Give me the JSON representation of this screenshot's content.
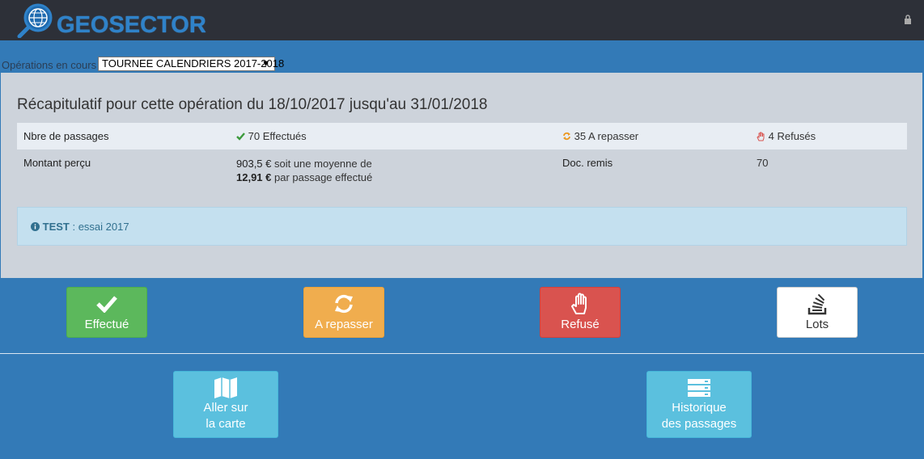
{
  "header": {
    "logo_text": "GEOSECTOR",
    "logo_icon": "globe-magnifier-icon",
    "lock_icon": "lock-icon"
  },
  "operation": {
    "label": "Opérations en cours :",
    "selected": "TOURNEE CALENDRIERS 2017-2018",
    "arrow": "▼"
  },
  "summary": {
    "title": "Récapitulatif pour cette opération du 18/10/2017 jusqu'au 31/01/2018",
    "passages_label": "Nbre de passages",
    "done": "70 Effectués",
    "redo": "35 A repasser",
    "refused": "4 Refusés",
    "amount_label": "Montant perçu",
    "amount_value": "903,5 €",
    "amount_mid": " soit une moyenne de",
    "avg_value": "12,91 €",
    "avg_suffix": " par passage effectué",
    "doc_label": "Doc. remis",
    "doc_value": "70"
  },
  "info": {
    "icon": "info-circle-icon",
    "bold": "TEST",
    "text": " : essai 2017"
  },
  "actions": {
    "done_label": "Effectué",
    "redo_label": "A repasser",
    "refused_label": "Refusé",
    "lots_label": "Lots"
  },
  "nav": {
    "map_line1": "Aller sur",
    "map_line2": "la carte",
    "history_line1": "Historique",
    "history_line2": "des passages"
  },
  "colors": {
    "topbar": "#2d3038",
    "background": "#337ab7",
    "panel": "#cdd3db",
    "success": "#5cb85c",
    "warning": "#f0ad4e",
    "danger": "#d9534f",
    "info": "#5bc0de"
  }
}
